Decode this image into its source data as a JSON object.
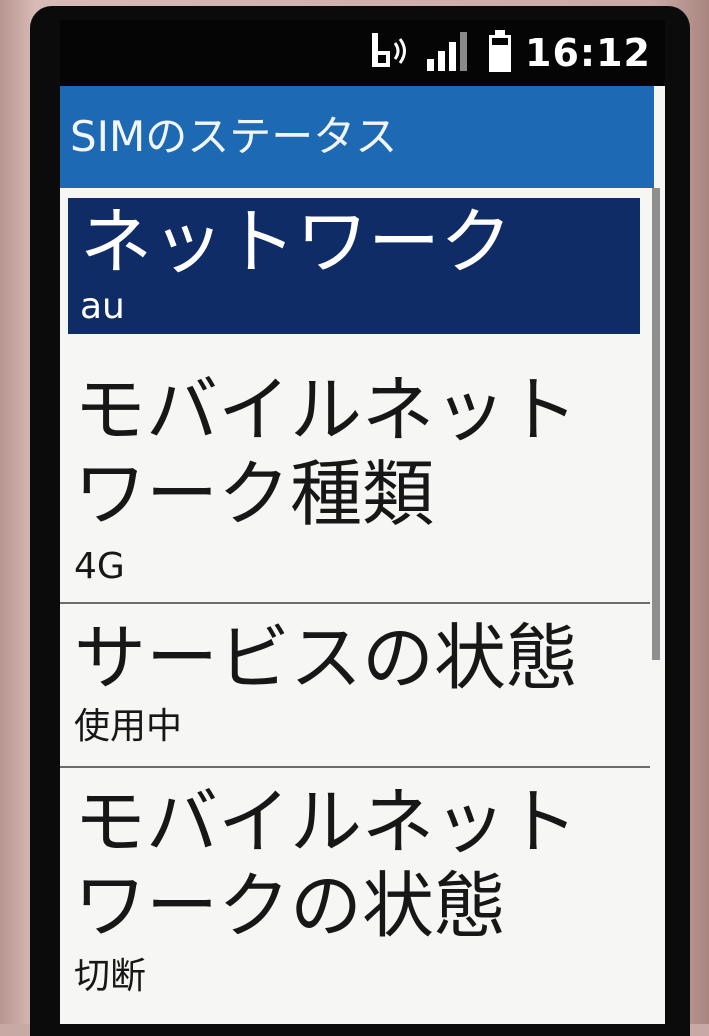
{
  "status_bar": {
    "time": "16:12",
    "icons": [
      "bluetooth-signal-icon",
      "cellular-signal-icon",
      "battery-icon"
    ]
  },
  "title_bar": {
    "title": "SIMのステータス"
  },
  "list": {
    "items": [
      {
        "title_lines": [
          "ネットワーク"
        ],
        "value": "au",
        "selected": true
      },
      {
        "title_lines": [
          "モバイルネット",
          "ワーク種類"
        ],
        "value": "4G",
        "selected": false
      },
      {
        "title_lines": [
          "サービスの状態"
        ],
        "value": "使用中",
        "selected": false
      },
      {
        "title_lines": [
          "モバイルネット",
          "ワークの状態"
        ],
        "value": "切断",
        "selected": false
      }
    ]
  },
  "colors": {
    "title_bar": "#1d69b3",
    "selected_highlight": "#0f2c66",
    "screen_background": "#f6f7f4",
    "status_bar": "#050505"
  }
}
